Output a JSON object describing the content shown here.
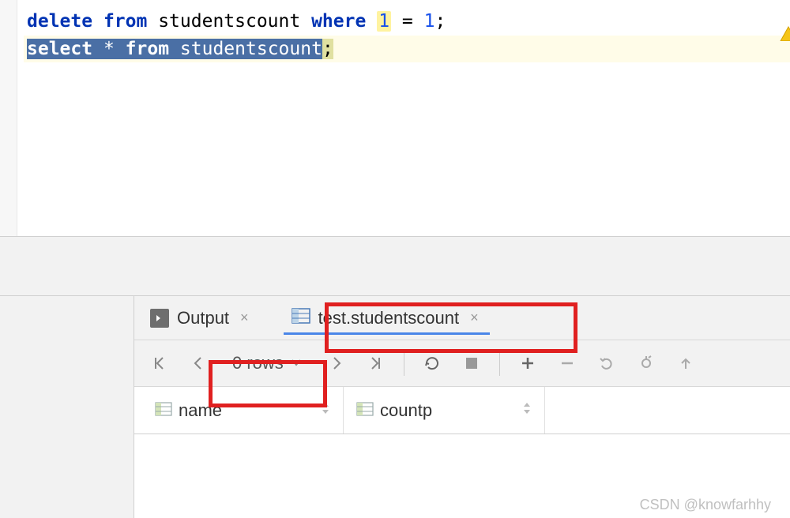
{
  "editor": {
    "line1": {
      "kw_delete": "delete",
      "kw_from": "from",
      "id_table": "studentscount",
      "kw_where": "where",
      "num1": "1",
      "eq": "=",
      "num2": "1",
      "semi": ";"
    },
    "line2": {
      "kw_select": "select",
      "star": "*",
      "kw_from": "from",
      "id_table": "studentscount",
      "semi": ";"
    }
  },
  "tabs": {
    "output": "Output",
    "table_tab": "test.studentscount"
  },
  "toolbar": {
    "rows_label": "0 rows"
  },
  "columns": [
    {
      "name": "name"
    },
    {
      "name": "countp"
    }
  ],
  "watermark": "CSDN @knowfarhhy"
}
